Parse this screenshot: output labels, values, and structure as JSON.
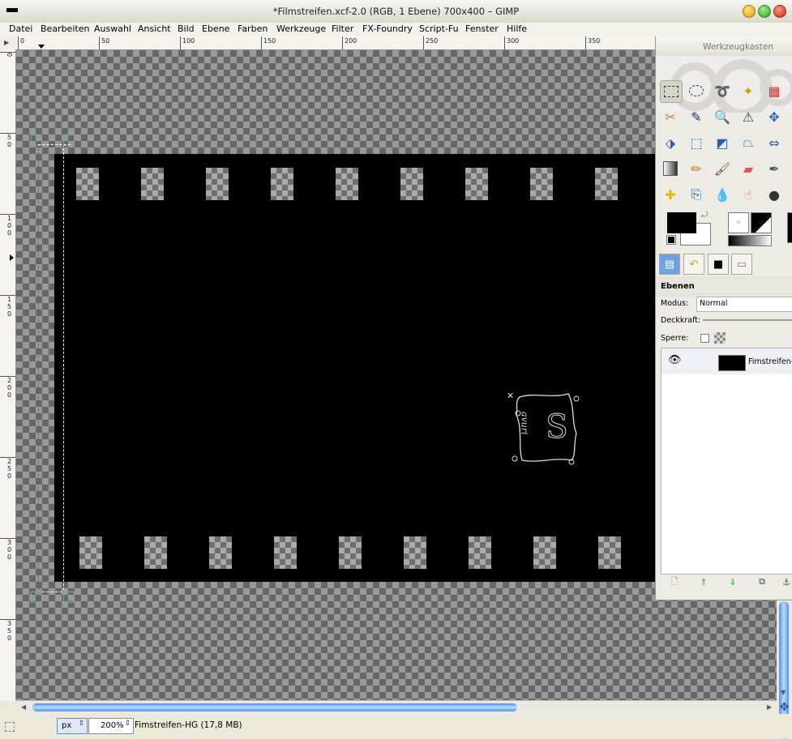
{
  "window": {
    "title": "*Filmstreifen.xcf-2.0 (RGB, 1 Ebene) 700x400 – GIMP"
  },
  "menubar": [
    "Datei",
    "Bearbeiten",
    "Auswahl",
    "Ansicht",
    "Bild",
    "Ebene",
    "Farben",
    "Werkzeuge",
    "Filter",
    "FX-Foundry",
    "Script-Fu",
    "Fenster",
    "Hilfe"
  ],
  "ruler_top_labels": [
    "0",
    "50",
    "100",
    "150",
    "200",
    "250",
    "300",
    "350"
  ],
  "ruler_left_labels": [
    "0",
    "50",
    "100",
    "150",
    "200",
    "250",
    "300",
    "350"
  ],
  "canvas": {
    "watermark_letters": "avuri",
    "watermark_symbol": "S"
  },
  "statusbar": {
    "unit": "px",
    "zoom": "200%",
    "info": "Fimstreifen-HG (17,8 MB)"
  },
  "toolbox": {
    "title": "Werkzeugkasten",
    "tools": [
      "rect-select-icon",
      "ellipse-select-icon",
      "lasso-icon",
      "fuzzy-select-icon",
      "color-select-icon",
      "scissors-icon",
      "color-picker-icon",
      "zoom-icon",
      "measure-icon",
      "move-icon",
      "align-icon",
      "crop-icon",
      "rotate-icon",
      "perspective-icon",
      "flip-icon",
      "gradient-icon",
      "pencil-icon",
      "paintbrush-icon",
      "eraser-icon",
      "airbrush-icon",
      "heal-icon",
      "clone-icon",
      "blur-icon",
      "smudge-icon",
      "dodge-icon"
    ]
  },
  "layers_panel": {
    "header": "Ebenen",
    "mode_label": "Modus:",
    "mode_value": "Normal",
    "opacity_label": "Deckkraft:",
    "lock_label": "Sperre:",
    "layers": [
      {
        "name": "Fimstreifen-HG"
      }
    ]
  },
  "colors": {
    "scroll_accent": "#4f93e8",
    "film": "#000000",
    "selection": "#ffffff"
  }
}
